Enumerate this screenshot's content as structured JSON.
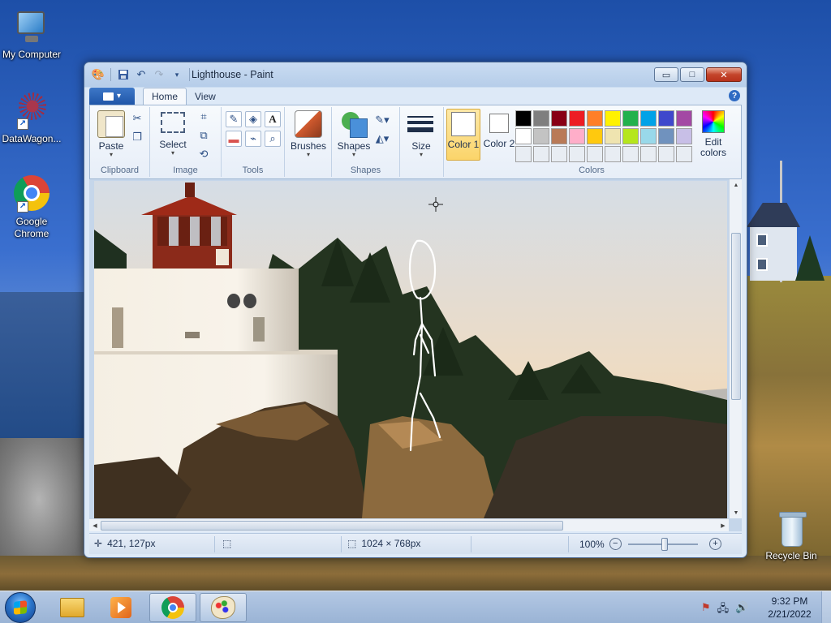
{
  "desktop": {
    "icons": [
      {
        "label": "My Computer"
      },
      {
        "label": "DataWagon..."
      },
      {
        "label": "Google Chrome"
      },
      {
        "label": "Recycle Bin"
      }
    ]
  },
  "window": {
    "title": "Lighthouse - Paint",
    "controls": {
      "minimize": "▭",
      "maximize": "□",
      "close": "✕"
    }
  },
  "ribbon": {
    "tabs": [
      {
        "label": "Home",
        "active": true
      },
      {
        "label": "View",
        "active": false
      }
    ],
    "help": "?",
    "groups": {
      "clipboard": {
        "label": "Clipboard",
        "paste": "Paste"
      },
      "image": {
        "label": "Image",
        "select": "Select"
      },
      "tools": {
        "label": "Tools"
      },
      "brushes": {
        "label": "Brushes"
      },
      "shapes": {
        "label": "Shapes",
        "button": "Shapes"
      },
      "size": {
        "label": "Size"
      },
      "colors": {
        "label": "Colors",
        "color1": "Color 1",
        "color2": "Color 2",
        "edit": "Edit colors",
        "palette_row1": [
          "#000000",
          "#7f7f7f",
          "#880015",
          "#ed1c24",
          "#ff7f27",
          "#fff200",
          "#22b14c",
          "#00a2e8",
          "#3f48cc",
          "#a349a4"
        ],
        "palette_row2": [
          "#ffffff",
          "#c3c3c3",
          "#b97a57",
          "#ffaec9",
          "#ffc90e",
          "#efe4b0",
          "#b5e61d",
          "#99d9ea",
          "#7092be",
          "#c8bfe7"
        ],
        "palette_row3": [
          "#e8edf3",
          "#e8edf3",
          "#e8edf3",
          "#e8edf3",
          "#e8edf3",
          "#e8edf3",
          "#e8edf3",
          "#e8edf3",
          "#e8edf3",
          "#e8edf3"
        ]
      }
    }
  },
  "statusbar": {
    "cursor_pos": "421, 127px",
    "image_size": "1024 × 768px",
    "zoom": "100%",
    "zoom_level": 1.0
  },
  "taskbar": {
    "time": "9:32 PM",
    "date": "2/21/2022"
  }
}
